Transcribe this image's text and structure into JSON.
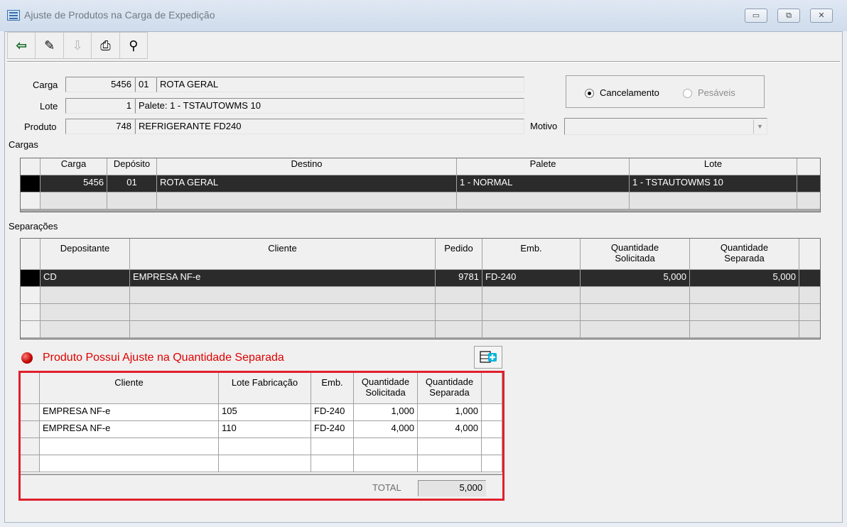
{
  "window": {
    "title": "Ajuste de Produtos na Carga de Expedição",
    "minimize_label": "▭",
    "restore_label": "⧉",
    "close_label": "✕"
  },
  "toolbar": {
    "buttons": [
      {
        "icon": "exit-door-icon",
        "glyph": "⇦"
      },
      {
        "icon": "pencil-icon",
        "glyph": "✎"
      },
      {
        "icon": "disabled-save-icon",
        "glyph": "⇩"
      },
      {
        "icon": "printer-icon",
        "glyph": "⎙"
      },
      {
        "icon": "binoculars-icon",
        "glyph": "⚲"
      }
    ]
  },
  "form": {
    "carga_label": "Carga",
    "carga_number": "5456",
    "carga_deposito": "01",
    "carga_rota": "ROTA GERAL",
    "lote_label": "Lote",
    "lote_number": "1",
    "lote_desc": "Palete: 1 - TSTAUTOWMS 10",
    "produto_label": "Produto",
    "produto_code": "748",
    "produto_desc": "REFRIGERANTE FD240",
    "motivo_label": "Motivo",
    "motivo_value": "",
    "radio_cancelamento": "Cancelamento",
    "radio_pesaveis": "Pesáveis"
  },
  "cargas": {
    "section_label": "Cargas",
    "columns": [
      "Carga",
      "Depósito",
      "Destino",
      "Palete",
      "Lote"
    ],
    "rows": [
      [
        "5456",
        "01",
        "ROTA GERAL",
        "1 - NORMAL",
        "1 - TSTAUTOWMS 10"
      ]
    ]
  },
  "separacoes": {
    "section_label": "Separações",
    "columns": [
      "Depositante",
      "Cliente",
      "Pedido",
      "Emb.",
      "Quantidade\nSolicitada",
      "Quantidade\nSeparada"
    ],
    "rows": [
      [
        "CD",
        "EMPRESA NF-e",
        "9781",
        "FD-240",
        "5,000",
        "5,000"
      ]
    ]
  },
  "ajuste": {
    "warning": "Produto Possui Ajuste na Quantidade Separada",
    "columns": [
      "Cliente",
      "Lote Fabricação",
      "Emb.",
      "Quantidade\nSolicitada",
      "Quantidade\nSeparada"
    ],
    "rows": [
      [
        "EMPRESA NF-e",
        "105",
        "FD-240",
        "1,000",
        "1,000"
      ],
      [
        "EMPRESA NF-e",
        "110",
        "FD-240",
        "4,000",
        "4,000"
      ]
    ],
    "total_label": "TOTAL",
    "total_value": "5,000"
  },
  "colors": {
    "warning_red": "#e00000",
    "highlight_border": "#e0202c",
    "selected_row": "#2b2b2b"
  }
}
